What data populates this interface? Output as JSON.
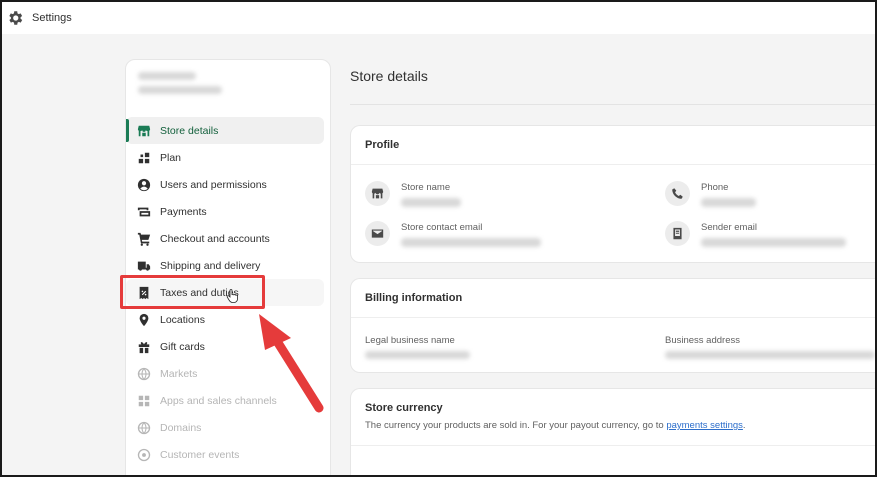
{
  "window": {
    "title": "Settings"
  },
  "sidebar": {
    "items": [
      {
        "label": "Store details",
        "icon": "store-icon",
        "state": "active"
      },
      {
        "label": "Plan",
        "icon": "plan-icon",
        "state": "normal"
      },
      {
        "label": "Users and permissions",
        "icon": "user-icon",
        "state": "normal"
      },
      {
        "label": "Payments",
        "icon": "payments-icon",
        "state": "normal"
      },
      {
        "label": "Checkout and accounts",
        "icon": "cart-icon",
        "state": "normal"
      },
      {
        "label": "Shipping and delivery",
        "icon": "truck-icon",
        "state": "normal"
      },
      {
        "label": "Taxes and duties",
        "icon": "receipt-icon",
        "state": "hover"
      },
      {
        "label": "Locations",
        "icon": "location-icon",
        "state": "normal"
      },
      {
        "label": "Gift cards",
        "icon": "gift-icon",
        "state": "normal"
      },
      {
        "label": "Markets",
        "icon": "globe-icon",
        "state": "faded"
      },
      {
        "label": "Apps and sales channels",
        "icon": "apps-icon",
        "state": "faded"
      },
      {
        "label": "Domains",
        "icon": "globe-icon",
        "state": "faded"
      },
      {
        "label": "Customer events",
        "icon": "events-icon",
        "state": "faded"
      }
    ]
  },
  "main": {
    "page_title": "Store details",
    "profile": {
      "heading": "Profile",
      "store_name_label": "Store name",
      "phone_label": "Phone",
      "contact_email_label": "Store contact email",
      "sender_email_label": "Sender email"
    },
    "billing": {
      "heading": "Billing information",
      "legal_name_label": "Legal business name",
      "address_label": "Business address"
    },
    "currency": {
      "heading": "Store currency",
      "description": "The currency your products are sold in. For your payout currency, go to ",
      "link": "payments settings",
      "suffix": "."
    }
  },
  "colors": {
    "accent_green": "#1a7b55",
    "highlight_red": "#e53b3b",
    "link_blue": "#2c6ecb"
  }
}
